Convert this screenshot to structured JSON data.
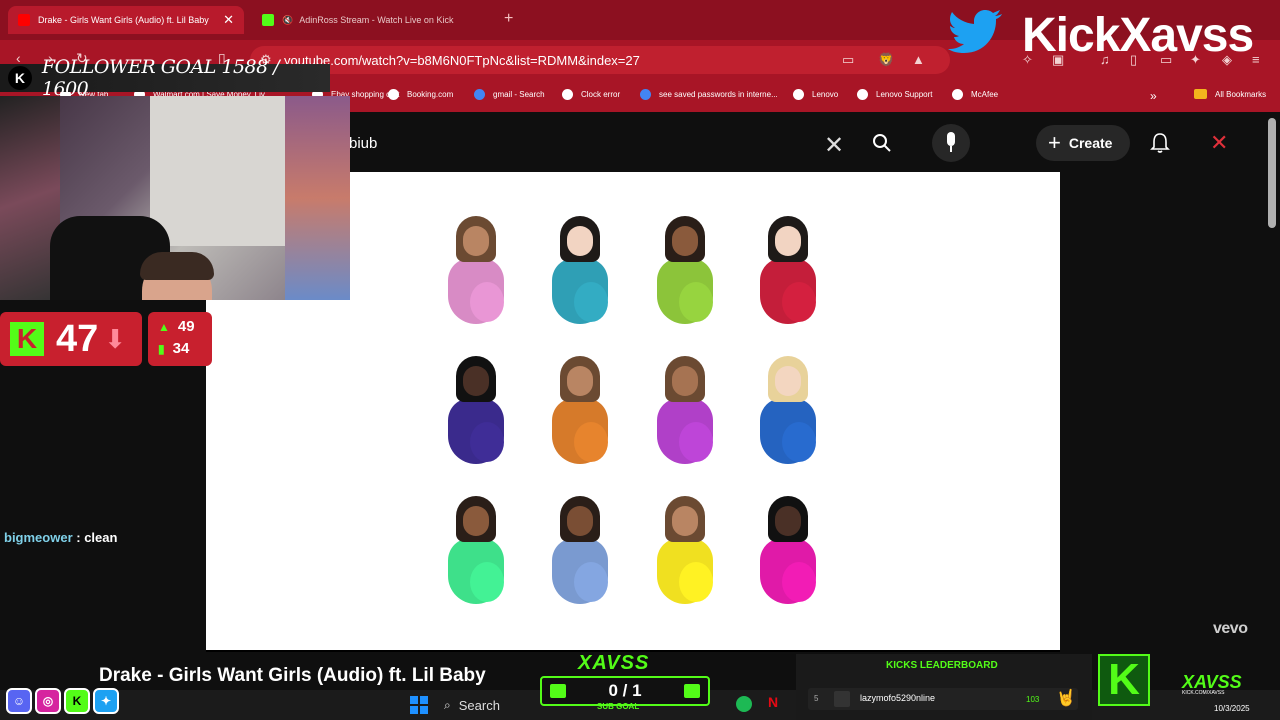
{
  "browser": {
    "tabs": [
      {
        "title": "Drake - Girls Want Girls (Audio) ft. Lil Baby",
        "active": true
      },
      {
        "title": "AdinRoss Stream - Watch Live on Kick",
        "active": false
      }
    ],
    "url": "youtube.com/watch?v=b8M6N0FTpNc&list=RDMM&index=27",
    "bookmarks": [
      {
        "label": "New tab"
      },
      {
        "label": "Walmart.com | Save Money. Liv..."
      },
      {
        "label": "Ebay shopping cart"
      },
      {
        "label": "Booking.com"
      },
      {
        "label": "gmail - Search"
      },
      {
        "label": "Clock error"
      },
      {
        "label": "see saved passwords in interne..."
      },
      {
        "label": "Lenovo"
      },
      {
        "label": "Lenovo Support"
      },
      {
        "label": "McAfee"
      },
      {
        "label": "All Bookmarks"
      }
    ],
    "overflow_label": "»",
    "new_tab_glyph": "+"
  },
  "youtube": {
    "search_value": "biub",
    "create_label": "Create",
    "watermark": "vevo"
  },
  "video_emojis": [
    {
      "hair": "#6b4a32",
      "skin": "#b98563",
      "shirt": "#d88bc5"
    },
    {
      "hair": "#1e1a18",
      "skin": "#f2d4c2",
      "shirt": "#2f9fb5"
    },
    {
      "hair": "#2a1e18",
      "skin": "#8a5a3c",
      "shirt": "#8cc43a"
    },
    {
      "hair": "#1e1a18",
      "skin": "#f2d4c2",
      "shirt": "#c41e3a"
    },
    {
      "hair": "#111111",
      "skin": "#4a3026",
      "shirt": "#3a2a8c"
    },
    {
      "hair": "#6b4a32",
      "skin": "#b98563",
      "shirt": "#d67a2a"
    },
    {
      "hair": "#6b4a32",
      "skin": "#a67352",
      "shirt": "#b040c8"
    },
    {
      "hair": "#e8d29a",
      "skin": "#f3d6c0",
      "shirt": "#2563c0"
    },
    {
      "hair": "#2a1e18",
      "skin": "#8a5a3c",
      "shirt": "#3ee08a"
    },
    {
      "hair": "#2a1e18",
      "skin": "#7a4e34",
      "shirt": "#7a9ad0"
    },
    {
      "hair": "#6b4a32",
      "skin": "#b98563",
      "shirt": "#f0e020"
    },
    {
      "hair": "#111111",
      "skin": "#4a3026",
      "shirt": "#e01aa8"
    }
  ],
  "overlay": {
    "follower_goal": "FOLLOWER GOAL 1588 / 1600",
    "kick_badge": "K",
    "brand": "KickXavss",
    "rank": "47",
    "stats_up": "49",
    "stats_bars": "34",
    "chat": {
      "user": "bigmeower",
      "separator": " : ",
      "message": "clean"
    },
    "song_title": "Drake - Girls Want Girls (Audio) ft. Lil Baby",
    "sub_goal": "0 / 1",
    "sub_goal_label": "SUB GOAL",
    "xavss_top": "XAVSS",
    "leaderboard": {
      "title": "KICKS LEADERBOARD",
      "rank": "5",
      "name": "lazymofo5290nline",
      "score": "103"
    },
    "logo_text": "XAVSS",
    "logo_url": "KICK.COM/XAVSS",
    "date": "10/3/2025"
  },
  "taskbar": {
    "search_label": "Search"
  },
  "colors": {
    "browser_red": "#a81526",
    "kick_green": "#53fc18",
    "overlay_red": "#c8202e"
  }
}
